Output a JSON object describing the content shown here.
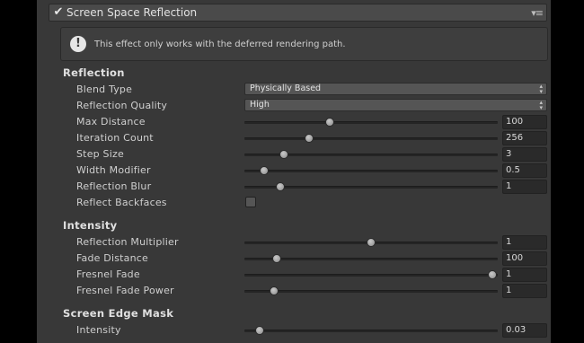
{
  "header": {
    "title": "Screen Space Reflection",
    "enabled": true,
    "check_glyph": "✔",
    "menu_glyph": "▾≡"
  },
  "help": {
    "icon": "!",
    "text": "This effect only works with the deferred rendering path."
  },
  "sections": {
    "reflection": "Reflection",
    "intensity": "Intensity",
    "screen_edge_mask": "Screen Edge Mask"
  },
  "reflection": {
    "blend_type": {
      "label": "Blend Type",
      "value": "Physically Based"
    },
    "reflection_quality": {
      "label": "Reflection Quality",
      "value": "High"
    },
    "max_distance": {
      "label": "Max Distance",
      "value": "100",
      "fraction": 0.33
    },
    "iteration_count": {
      "label": "Iteration Count",
      "value": "256",
      "fraction": 0.245
    },
    "step_size": {
      "label": "Step Size",
      "value": "3",
      "fraction": 0.14
    },
    "width_modifier": {
      "label": "Width Modifier",
      "value": "0.5",
      "fraction": 0.06
    },
    "reflection_blur": {
      "label": "Reflection Blur",
      "value": "1",
      "fraction": 0.125
    },
    "reflect_backfaces": {
      "label": "Reflect Backfaces",
      "checked": false
    }
  },
  "intensity": {
    "reflection_multiplier": {
      "label": "Reflection Multiplier",
      "value": "1",
      "fraction": 0.5
    },
    "fade_distance": {
      "label": "Fade Distance",
      "value": "100",
      "fraction": 0.11
    },
    "fresnel_fade": {
      "label": "Fresnel Fade",
      "value": "1",
      "fraction": 1.0
    },
    "fresnel_fade_power": {
      "label": "Fresnel Fade Power",
      "value": "1",
      "fraction": 0.1
    }
  },
  "screen_edge_mask": {
    "intensity": {
      "label": "Intensity",
      "value": "0.03",
      "fraction": 0.04
    }
  },
  "dropdown_arrow": "▴▾"
}
